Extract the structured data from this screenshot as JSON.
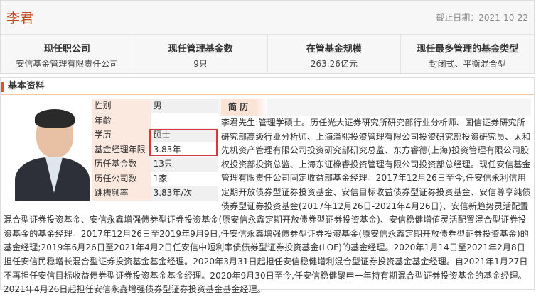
{
  "header": {
    "name": "李君",
    "date_label": "截止日期：2021-10-22"
  },
  "stats": [
    {
      "label": "现任职公司",
      "value": "安信基金管理有限责任公司"
    },
    {
      "label": "现任管理基金数",
      "value": "9只"
    },
    {
      "label": "在管基金规模",
      "value": "263.26亿元"
    },
    {
      "label": "现任最多管理的基金类型",
      "value": "封闭式、平衡混合型"
    }
  ],
  "section": {
    "title": "基本资料"
  },
  "profile": [
    {
      "label": "性别",
      "value": "男"
    },
    {
      "label": "年龄",
      "value": "-"
    },
    {
      "label": "学历",
      "value": "硕士"
    },
    {
      "label": "基金经理年限",
      "value": "3.83年"
    },
    {
      "label": "历任基金数",
      "value": "13只"
    },
    {
      "label": "历任公司数",
      "value": "1家"
    },
    {
      "label": "跳槽频率",
      "value": "3.83年/次"
    }
  ],
  "bio": {
    "title": "简 历",
    "text": "李君先生:管理学硕士。历任光大证券研究所研究部行业分析师、国信证券研究所研究部高级行业分析师、上海泽熙投资管理有限公司投资研究部投资研究员、太和先机资产管理有限公司投资研究部研究总监、东方睿德(上海)投资管理有限公司股权投资部投资总监、上海东证橡睿投资管理有限公司投资部总经理。现任安信基金管理有限责任公司固定收益部基金经理。2017年12月26日至今,任安信永利信用定期开放债券型证券投资基金、安信目标收益债券型证券投资基金、安信尊享纯债债券型证券投资基金(2017年12月26日-2021年4月26日)、安信新趋势灵活配置混合型证券投资基金、安信永鑫增强债券型证券投资基金(原安信永鑫定期开放债券型证券投资基金)、安信稳健增值灵活配置混合型证券投资基金的基金经理。2017年12月26日至2019年9月9日,任安信永鑫增强债券型证券投资基金(原安信永鑫定期开放债券型证券投资基金)的基金经理;2019年6月26日至2021年4月2日任安信中短利率债债券型证券投资基金(LOF)的基金经理。2020年1月14日至2021年2月8日担任安信民稳增长混合型证券投资基金基金经理。2020年3月31日起担任安信稳健增利混合型证券投资基金基金经理。自2021年1月27日不再担任安信目标收益债券型证券投资基金基金经理。2020年9月30日至今,任安信稳健聚申一年持有期混合型证券投资基金的基金经理。2021年4月26日起担任安信永鑫增强债券型证券投资基金基金经理。"
  },
  "colors": {
    "accent": "#c8461e",
    "highlight": "#d9363e"
  }
}
